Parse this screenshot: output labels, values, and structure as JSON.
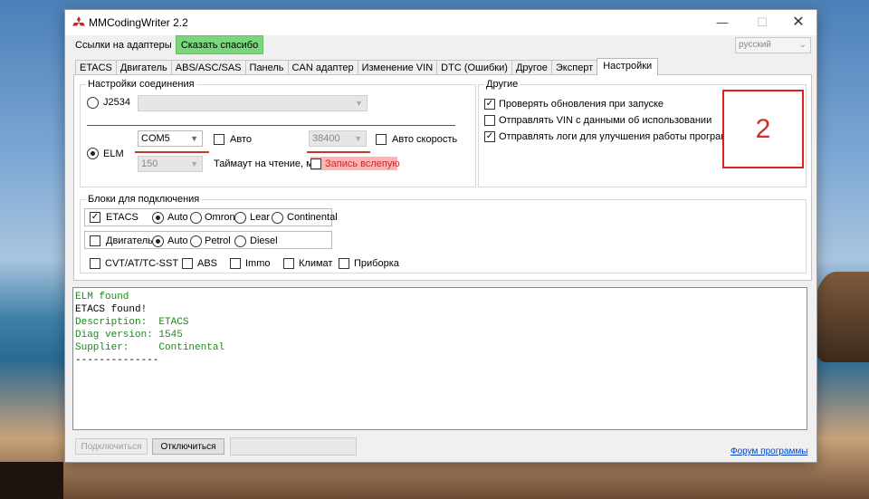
{
  "window": {
    "title": "MMCodingWriter 2.2",
    "controls": {
      "minimize": "—",
      "maximize": "☐",
      "close": "✕"
    },
    "icon": "red-logo-icon"
  },
  "top": {
    "adapters_link": "Ссылки на адаптеры",
    "thanks_button": "Сказать спасибо",
    "language": "русский"
  },
  "tabs": [
    "ETACS",
    "Двигатель",
    "ABS/ASC/SAS",
    "Панель",
    "CAN адаптер",
    "Изменение VIN",
    "DTC (Ошибки)",
    "Другое",
    "Эксперт",
    "Настройки"
  ],
  "connection": {
    "group_title": "Настройки соединения",
    "j2534_label": "J2534",
    "j2534_value": "",
    "elm_label": "ELM",
    "port_value": "COM5",
    "auto_label": "Авто",
    "baud_value": "38400",
    "auto_speed_label": "Авто скорость",
    "timeout_value": "150",
    "timeout_label": "Таймаут на чтение, мс",
    "blind_write_label": "Запись вслепую"
  },
  "other": {
    "group_title": "Другие",
    "options": [
      {
        "label": "Проверять обновления при запуске",
        "checked": true
      },
      {
        "label": "Отправлять VIN с данными об использовании",
        "checked": false
      },
      {
        "label": "Отправлять логи для улучшения работы программы",
        "checked": true
      }
    ]
  },
  "blocks": {
    "group_title": "Блоки для подключения",
    "etacs": {
      "label": "ETACS",
      "checked": true,
      "options": [
        "Auto",
        "Omron",
        "Lear",
        "Continental"
      ]
    },
    "engine": {
      "label": "Двигатель",
      "checked": false,
      "options": [
        "Auto",
        "Petrol",
        "Diesel"
      ]
    },
    "extra": [
      "CVT/AT/TC-SST",
      "ABS",
      "Immo",
      "Климат",
      "Приборка"
    ]
  },
  "log": [
    {
      "text": "ELM found",
      "color": "#1a8a1a"
    },
    {
      "text": "ETACS found!",
      "color": "#000000"
    },
    {
      "text": "Description:  ETACS",
      "color": "#1a8a1a"
    },
    {
      "text": "Diag version: 1545",
      "color": "#1a8a1a"
    },
    {
      "text": "Supplier:     Continental",
      "color": "#1a8a1a"
    },
    {
      "text": "--------------",
      "color": "#000000"
    }
  ],
  "bottom": {
    "connect_button": "Подключиться",
    "disconnect_button": "Отключиться",
    "forum_link": "Форум программы"
  },
  "annotation": {
    "text": "2",
    "color": "#e02020"
  }
}
